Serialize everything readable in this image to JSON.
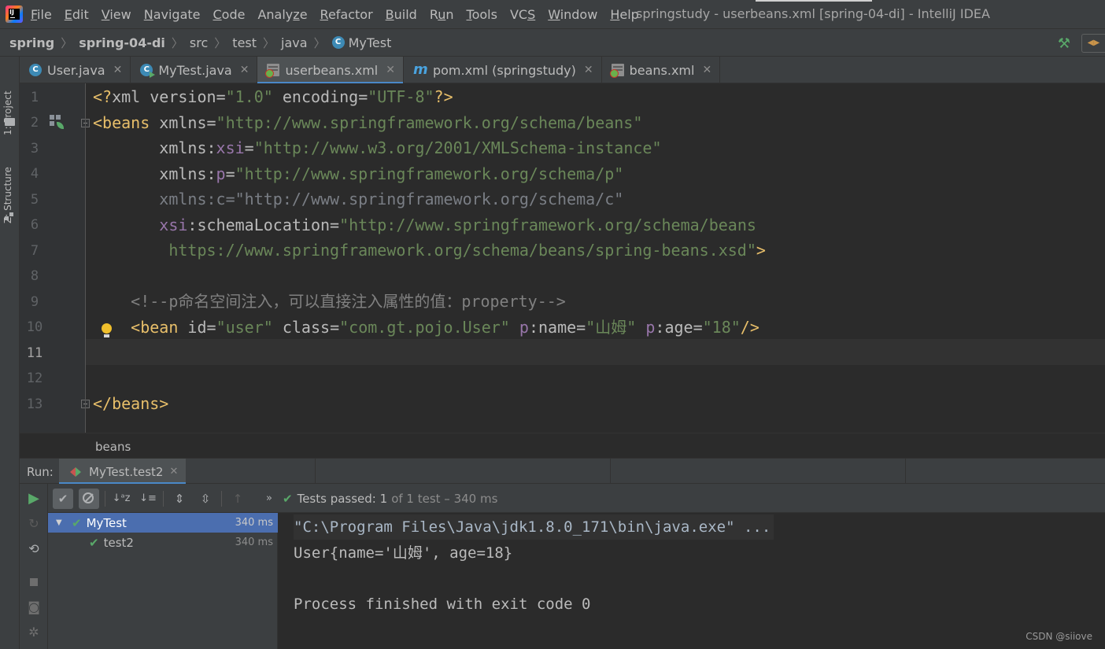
{
  "menubar": {
    "items": [
      {
        "label": "File",
        "mnemonic": "F",
        "rest": "ile"
      },
      {
        "label": "Edit",
        "mnemonic": "E",
        "rest": "dit"
      },
      {
        "label": "View",
        "mnemonic": "V",
        "rest": "iew"
      },
      {
        "label": "Navigate",
        "mnemonic": "N",
        "rest": "avigate"
      },
      {
        "label": "Code",
        "mnemonic": "C",
        "rest": "ode"
      },
      {
        "label": "Analyze",
        "mnemonic": "z",
        "pre": "Analy",
        "rest": "e"
      },
      {
        "label": "Refactor",
        "mnemonic": "R",
        "rest": "efactor"
      },
      {
        "label": "Build",
        "mnemonic": "B",
        "rest": "uild"
      },
      {
        "label": "Run",
        "mnemonic": "u",
        "pre": "R",
        "rest": "n"
      },
      {
        "label": "Tools",
        "mnemonic": "T",
        "rest": "ools"
      },
      {
        "label": "VCS",
        "mnemonic": "S",
        "pre": "VC",
        "rest": ""
      },
      {
        "label": "Window",
        "mnemonic": "W",
        "rest": "indow"
      },
      {
        "label": "Help",
        "mnemonic": "H",
        "rest": "elp"
      }
    ],
    "window_title": "springstudy - userbeans.xml [spring-04-di] - IntelliJ IDEA"
  },
  "navbar": {
    "project": "spring",
    "module": "spring-04-di",
    "path": [
      "src",
      "test",
      "java"
    ],
    "file": "MyTest"
  },
  "sidebar": {
    "project_tab": "1: Project",
    "structure_tab": "Z: Structure"
  },
  "tabs": [
    {
      "label": "User.java",
      "icon": "java-class-icon"
    },
    {
      "label": "MyTest.java",
      "icon": "java-test-class-icon"
    },
    {
      "label": "userbeans.xml",
      "icon": "spring-xml-icon",
      "active": true
    },
    {
      "label": "pom.xml (springstudy)",
      "icon": "maven-icon"
    },
    {
      "label": "beans.xml",
      "icon": "spring-xml-icon"
    }
  ],
  "editor": {
    "line_numbers": [
      "1",
      "2",
      "3",
      "4",
      "5",
      "6",
      "7",
      "8",
      "9",
      "10",
      "11",
      "12",
      "13"
    ],
    "current_line": "11",
    "breadcrumb": "beans",
    "tokens": {
      "l1_open": "<?",
      "l1_xml": "xml ",
      "l1_version_attr": "version",
      "l1_eq1": "=",
      "l1_version_val": "\"1.0\"",
      "l1_encoding_attr": " encoding",
      "l1_eq2": "=",
      "l1_encoding_val": "\"UTF-8\"",
      "l1_close": "?>",
      "l2_tag": "<beans",
      "l2_attr": " xmlns",
      "l2_eq": "=",
      "l2_val": "\"http://www.springframework.org/schema/beans\"",
      "l3_attr": "xmlns:",
      "l3_ns": "xsi",
      "l3_eq": "=",
      "l3_val": "\"http://www.w3.org/2001/XMLSchema-instance\"",
      "l4_attr": "xmlns:",
      "l4_ns": "p",
      "l4_eq": "=",
      "l4_val": "\"http://www.springframework.org/schema/p\"",
      "l5_text": "xmlns:c=\"http://www.springframework.org/schema/c\"",
      "l6_ns": "xsi",
      "l6_attr": ":schemaLocation",
      "l6_eq": "=",
      "l6_val": "\"http://www.springframework.org/schema/beans",
      "l7_val": " https://www.springframework.org/schema/beans/spring-beans.xsd\"",
      "l7_close": ">",
      "l9_comment": "<!--p命名空间注入，可以直接注入属性的值：property-->",
      "l10_tag": "<bean",
      "l10_id_attr": " id",
      "l10_eq1": "=",
      "l10_id_val": "\"user\"",
      "l10_class_attr": " class",
      "l10_eq2": "=",
      "l10_class_val": "\"com.gt.pojo.User\"",
      "l10_p1": " p",
      "l10_name_attr": ":name",
      "l10_eq3": "=",
      "l10_name_val": "\"山姆\"",
      "l10_p2": " p",
      "l10_age_attr": ":age",
      "l10_eq4": "=",
      "l10_age_val": "\"18\"",
      "l10_close": "/>",
      "l13_tag": "</beans>"
    }
  },
  "run": {
    "label": "Run:",
    "tab_label": "MyTest.test2",
    "status_prefix": "Tests passed:",
    "status_count": "1",
    "status_detail": "of 1 test – 340 ms",
    "tree": [
      {
        "name": "MyTest",
        "duration": "340 ms"
      },
      {
        "name": "test2",
        "duration": "340 ms"
      }
    ],
    "console": [
      "\"C:\\Program Files\\Java\\jdk1.8.0_171\\bin\\java.exe\" ...",
      "User{name='山姆', age=18}",
      "",
      "Process finished with exit code 0"
    ],
    "watermark": "CSDN @siiove"
  },
  "colors": {
    "tag": "#e8bf6a",
    "string": "#6a8759",
    "namespace": "#9876aa",
    "comment": "#808080",
    "accent": "#4a88c7",
    "success": "#59a869"
  }
}
